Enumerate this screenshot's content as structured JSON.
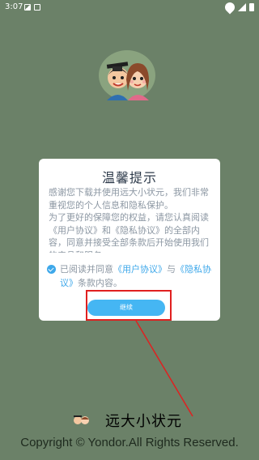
{
  "status_bar": {
    "time": "3:07",
    "icons": [
      "image-icon",
      "notification-icon",
      "wifi-icon",
      "signal-icon",
      "battery-icon"
    ]
  },
  "dialog": {
    "title": "温馨提示",
    "body_paragraph_1": "感谢您下载并使用远大小状元，我们非常重视您的个人信息和隐私保护。",
    "body_paragraph_2": "为了更好的保障您的权益，请您认真阅读《用户协议》和《隐私协议》的全部内容，同意并接受全部条款后开始使用我们的产品和服务。",
    "agree_prefix": "已阅读并同意",
    "user_agreement_link": "《用户协议》",
    "agree_and": "与",
    "privacy_agreement_link": "《隐私协议》",
    "agree_suffix": "条款内容。",
    "continue_label": "继续"
  },
  "footer": {
    "brand_name": "远大小状元",
    "copyright": "Copyright © Yondor.All Rights Reserved."
  },
  "colors": {
    "background": "#6b8168",
    "accent": "#3ea8ea",
    "button": "#45b6f3",
    "highlight": "#e02020"
  }
}
